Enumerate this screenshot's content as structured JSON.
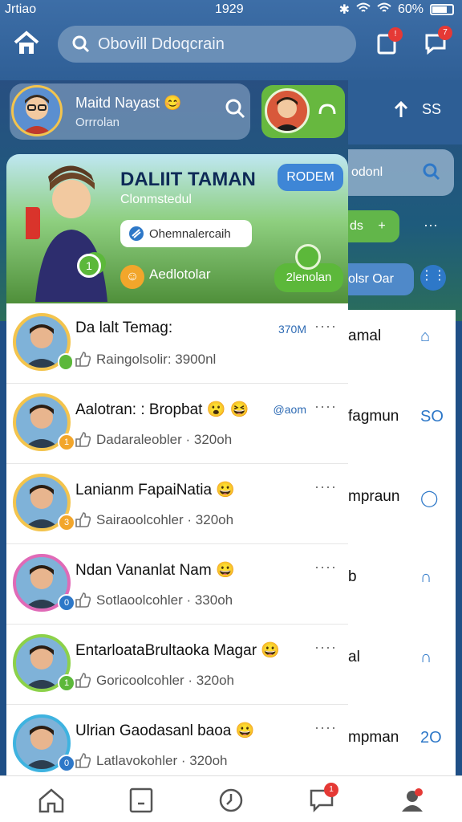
{
  "status": {
    "carrier": "Jrtiao",
    "time": "1929",
    "battery": "60%"
  },
  "topbar": {
    "search_placeholder": "Obovill Ddoqcrain",
    "notif_badge": "!",
    "chat_badge": "7"
  },
  "profile": {
    "name": "Maitd Nayast 😊",
    "subtitle": "Orrrolan"
  },
  "hero": {
    "title": "DALIIT TAMAN",
    "subtitle": "Clonmstedul",
    "button": "RODEM",
    "pill": "Ohemnalercaih",
    "label": "Aedlotolar",
    "pill2": "2lenolan",
    "badge": "1"
  },
  "contacts": [
    {
      "name": "Da lalt Temag:",
      "sub": "Raingolsolir: 3900nl",
      "meta": "370M",
      "badge": "",
      "badge_color": "#5cb83a",
      "border": "#f3c44d"
    },
    {
      "name": "Aalotran: : Bropbat 😮 😆",
      "sub": "Dadaraleobler · 320oh",
      "meta": "@aom",
      "badge": "1",
      "badge_color": "#f2a62b",
      "border": "#f3c44d"
    },
    {
      "name": "Lanianm FapaiNatia 😀",
      "sub": "Sairaoolcohler · 320oh",
      "meta": "",
      "badge": "3",
      "badge_color": "#f2a62b",
      "border": "#f3c44d"
    },
    {
      "name": "Ndan Vananlat Nam 😀",
      "sub": "Sotlaoolcohler · 330oh",
      "meta": "",
      "badge": "0",
      "badge_color": "#2e78c8",
      "border": "#e06ab7"
    },
    {
      "name": "EntarloataBrultaoka Magar 😀",
      "sub": "Goricoolcohler · 320oh",
      "meta": "",
      "badge": "1",
      "badge_color": "#5cb83a",
      "border": "#8cd14a"
    },
    {
      "name": "Ulrian Gaodasanl baoa 😀",
      "sub": "Latlavokohler · 320oh",
      "meta": "",
      "badge": "0",
      "badge_color": "#2e78c8",
      "border": "#3eb3e0"
    }
  ],
  "right_panel": {
    "box_text": "odonl",
    "pill_text": "ds",
    "bar_text": "olsr Oar",
    "rows": [
      {
        "text": "amal",
        "icon": "⌂"
      },
      {
        "text": "fagmun",
        "icon": "SO"
      },
      {
        "text": "mpraun",
        "icon": "◯"
      },
      {
        "text": "b",
        "icon": "∩"
      },
      {
        "text": "al",
        "icon": "∩"
      },
      {
        "text": "mpman",
        "icon": "2O"
      }
    ]
  },
  "bottom_nav": {
    "chat_badge": "1"
  }
}
